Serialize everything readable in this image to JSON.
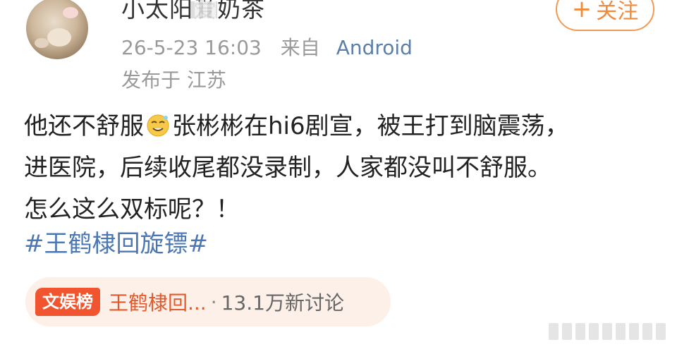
{
  "post_header": {
    "username": "小太阳爱奶茶",
    "timestamp": "26-5-23 16:03",
    "from_label": "来自",
    "device": "Android",
    "location": "发布于 江苏"
  },
  "follow_button": {
    "plus": "+",
    "label": "关注"
  },
  "post": {
    "line1_a": "他还不舒服",
    "line1_b": "张彬彬在hi6剧宣，被王打到脑震荡，",
    "line2": "进医院，后续收尾都没录制，人家都没叫不舒服。",
    "line3": "怎么这么双标呢？！",
    "emoji_icon": "smirk-emoji-icon",
    "hashtag": "#王鹤棣回旋镖#"
  },
  "topic": {
    "badge": "文娱榜",
    "name": "王鹤棣回...",
    "separator": "·",
    "count": "13.1万新讨论"
  },
  "colors": {
    "accent_orange": "#f28a3c",
    "link_blue": "#4b78b4",
    "badge_red": "#f0552f"
  }
}
